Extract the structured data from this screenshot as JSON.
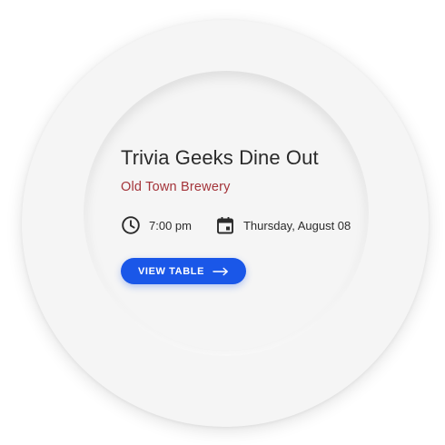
{
  "event": {
    "title": "Trivia Geeks Dine Out",
    "venue": "Old Town Brewery",
    "time": "7:00 pm",
    "date": "Thursday, August 08"
  },
  "actions": {
    "view_table_label": "VIEW TABLE"
  },
  "colors": {
    "venue": "#a4343a",
    "button": "#1a57e8",
    "plate": "#f5f5f5"
  },
  "icons": {
    "time": "clock-icon",
    "date": "calendar-icon",
    "button": "arrow-right-icon"
  }
}
